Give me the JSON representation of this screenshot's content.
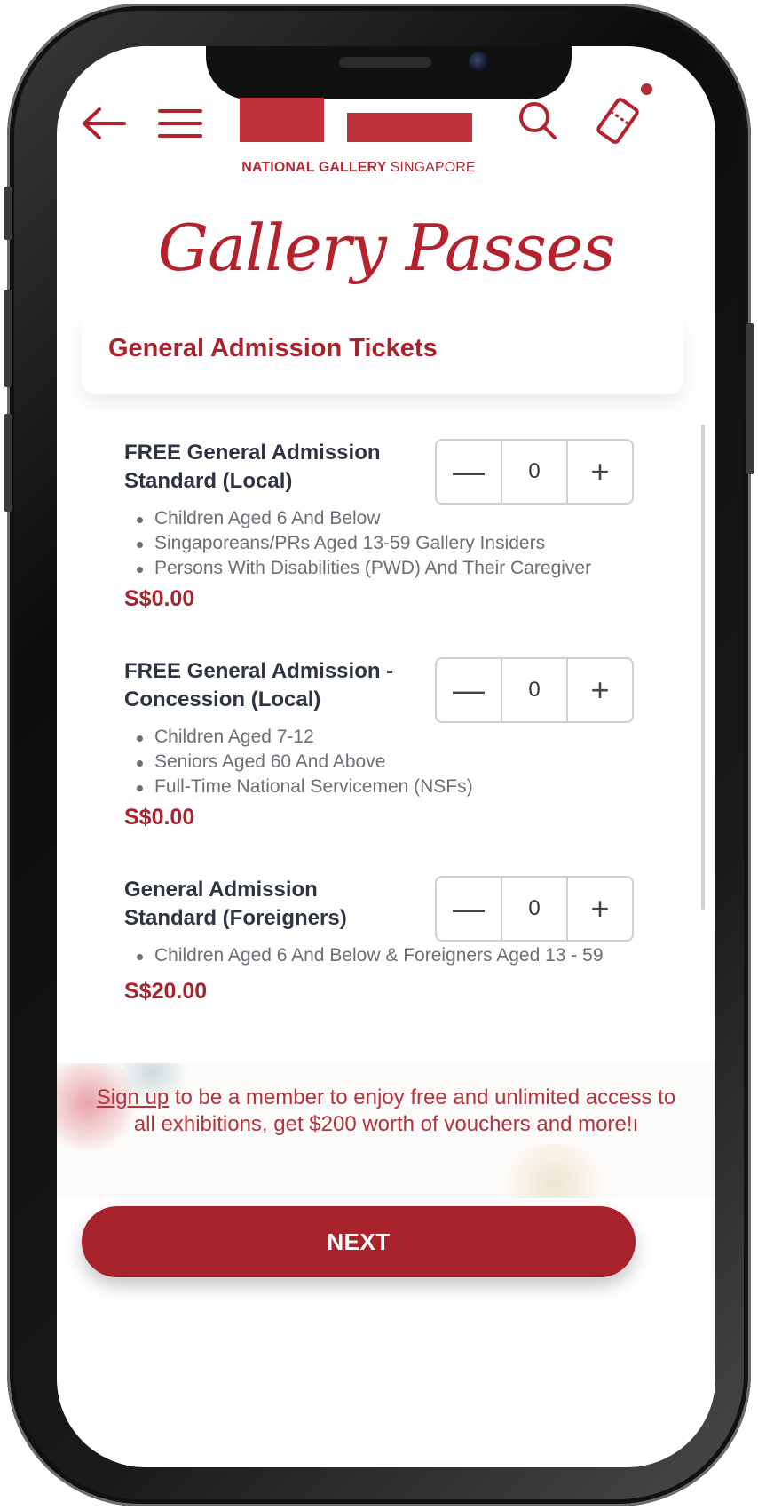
{
  "brand": {
    "name_bold": "NATIONAL GALLERY",
    "name_light": "SINGAPORE",
    "color": "#b4232d"
  },
  "header": {
    "back_icon": "arrow-left-icon",
    "menu_icon": "hamburger-menu-icon",
    "search_icon": "search-icon",
    "cart_icon": "ticket-icon"
  },
  "page": {
    "title": "Gallery Passes"
  },
  "section": {
    "title": "General Admission Tickets"
  },
  "tickets": [
    {
      "name": "FREE General Admission Standard (Local)",
      "bullets": [
        "Children Aged 6 And Below",
        "Singaporeans/PRs Aged 13-59 Gallery Insiders",
        "Persons With Disabilities (PWD) And Their Caregiver"
      ],
      "price": "S$0.00",
      "quantity": "0",
      "minus": "—",
      "plus": "+"
    },
    {
      "name": "FREE General Admission - Concession (Local)",
      "bullets": [
        "Children Aged 7-12",
        "Seniors Aged 60 And Above",
        "Full-Time National Servicemen (NSFs)"
      ],
      "price": "S$0.00",
      "quantity": "0",
      "minus": "—",
      "plus": "+"
    },
    {
      "name": "General Admission Standard (Foreigners)",
      "bullets": [
        "Children Aged 6 And Below & Foreigners  Aged 13 - 59"
      ],
      "price": "S$20.00",
      "quantity": "0",
      "minus": "—",
      "plus": "+"
    }
  ],
  "member_banner": {
    "link_text": "Sign up",
    "text": " to be a member to enjoy free and unlimited access to all exhibitions, get $200 worth of vouchers and more!ı"
  },
  "footer": {
    "next_label": "NEXT"
  }
}
